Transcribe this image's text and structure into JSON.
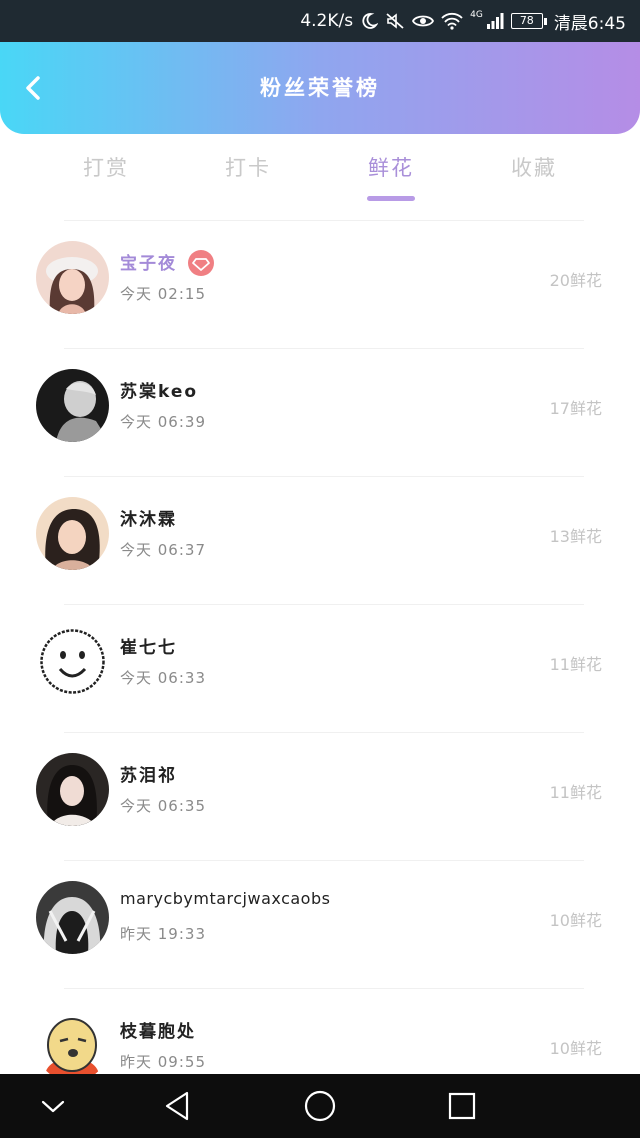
{
  "status_bar": {
    "speed": "4.2K/s",
    "network": "4G",
    "battery": "78",
    "time": "清晨6:45"
  },
  "header": {
    "title": "粉丝荣誉榜"
  },
  "tabs": [
    {
      "label": "打赏",
      "active": false
    },
    {
      "label": "打卡",
      "active": false
    },
    {
      "label": "鲜花",
      "active": true
    },
    {
      "label": "收藏",
      "active": false
    }
  ],
  "fans": [
    {
      "name": "宝子夜",
      "time": "今天 02:15",
      "count": "20鲜花",
      "vip": true
    },
    {
      "name": "苏棠keo",
      "time": "今天 06:39",
      "count": "17鲜花",
      "vip": false
    },
    {
      "name": "沐沐霖",
      "time": "今天 06:37",
      "count": "13鲜花",
      "vip": false
    },
    {
      "name": "崔七七",
      "time": "今天 06:33",
      "count": "11鲜花",
      "vip": false
    },
    {
      "name": "苏泪祁",
      "time": "今天 06:35",
      "count": "11鲜花",
      "vip": false
    },
    {
      "name": "marycbymtarcjwaxcaobs",
      "time": "昨天 19:33",
      "count": "10鲜花",
      "vip": false
    },
    {
      "name": "枝暮胞处",
      "time": "昨天 09:55",
      "count": "10鲜花",
      "vip": false
    }
  ],
  "colors": {
    "header_gradient_start": "#49d7f6",
    "header_gradient_end": "#b58de6",
    "accent": "#a98fd9",
    "vip_badge": "#f07f83"
  },
  "icons": {
    "back": "chevron-left-icon",
    "vip": "diamond-icon",
    "nav": [
      "chevron-down-icon",
      "back-triangle-icon",
      "home-circle-icon",
      "recents-square-icon"
    ]
  }
}
